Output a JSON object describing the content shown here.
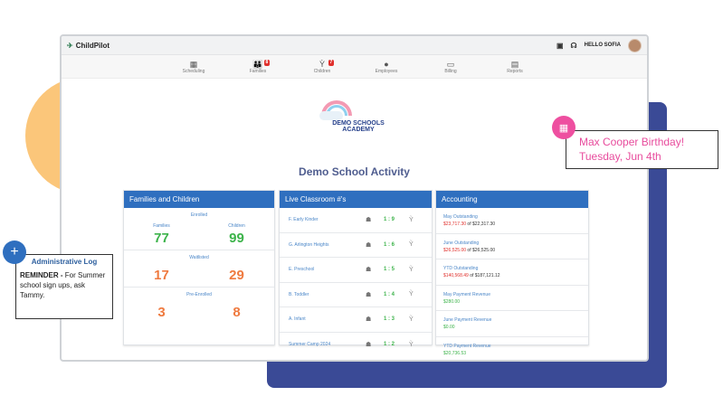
{
  "app": {
    "name": "ChildPilot",
    "greeting": "HELLO SOFIA"
  },
  "nav": [
    {
      "label": "Scheduling",
      "icon": "calendar-icon",
      "glyph": "▦",
      "badge": ""
    },
    {
      "label": "Families",
      "icon": "family-icon",
      "glyph": "👪",
      "badge": "8"
    },
    {
      "label": "Children",
      "icon": "child-icon",
      "glyph": "Ỳ",
      "badge": "7"
    },
    {
      "label": "Employees",
      "icon": "apple-icon",
      "glyph": "●",
      "badge": ""
    },
    {
      "label": "Billing",
      "icon": "billing-icon",
      "glyph": "▭",
      "badge": ""
    },
    {
      "label": "Reports",
      "icon": "reports-icon",
      "glyph": "▤",
      "badge": ""
    }
  ],
  "brand": {
    "line1": "DEMO SCHOOLS",
    "line2": "ACADEMY"
  },
  "page_title": "Demo School Activity",
  "families_panel": {
    "title": "Families and Children",
    "sections": [
      {
        "label": "Enrolled",
        "col1": "Families",
        "col2": "Children",
        "val1": "77",
        "val2": "99",
        "color": "green"
      },
      {
        "label": "Waitlisted",
        "col1": "",
        "col2": "",
        "val1": "17",
        "val2": "29",
        "color": "orange"
      },
      {
        "label": "Pre-Enrolled",
        "col1": "",
        "col2": "",
        "val1": "3",
        "val2": "8",
        "color": "orange"
      }
    ]
  },
  "classroom_panel": {
    "title": "Live Classroom #'s",
    "rows": [
      {
        "name": "F. Early Kinder",
        "ratio": "1 : 9"
      },
      {
        "name": "G. Arlington Heights",
        "ratio": "1 : 6"
      },
      {
        "name": "E. Preschool",
        "ratio": "1 : 5"
      },
      {
        "name": "B. Toddler",
        "ratio": "1 : 4"
      },
      {
        "name": "A. Infant",
        "ratio": "1 : 3"
      },
      {
        "name": "Summer Camp 2024",
        "ratio": "1 : 2"
      }
    ]
  },
  "accounting_panel": {
    "title": "Accounting",
    "rows": [
      {
        "label": "May Outstanding",
        "value_red": "$23,717.30",
        "value_rest": " of $22,317.30"
      },
      {
        "label": "June Outstanding",
        "value_red": "$26,525.00",
        "value_rest": " of $26,525.00"
      },
      {
        "label": "YTD Outstanding",
        "value_red": "$140,568.49",
        "value_rest": " of $187,121.12"
      },
      {
        "label": "May Payment Revenue",
        "value_green": "$280.00"
      },
      {
        "label": "June Payment Revenue",
        "value_green": "$0.00"
      },
      {
        "label": "YTD Payment Revenue",
        "value_green": "$20,736.53"
      }
    ]
  },
  "birthday_note": {
    "line1": "Max Cooper Birthday!",
    "line2": "Tuesday, Jun 4th"
  },
  "admin_note": {
    "title": "Administrative Log",
    "prefix": "REMINDER -",
    "body": " For Summer school sign ups, ask Tammy."
  },
  "colors": {
    "header_blue": "#2f6fbf",
    "green": "#3cb34a",
    "orange": "#ef7a3f",
    "red": "#e0302c",
    "pink": "#ee4fa0"
  }
}
